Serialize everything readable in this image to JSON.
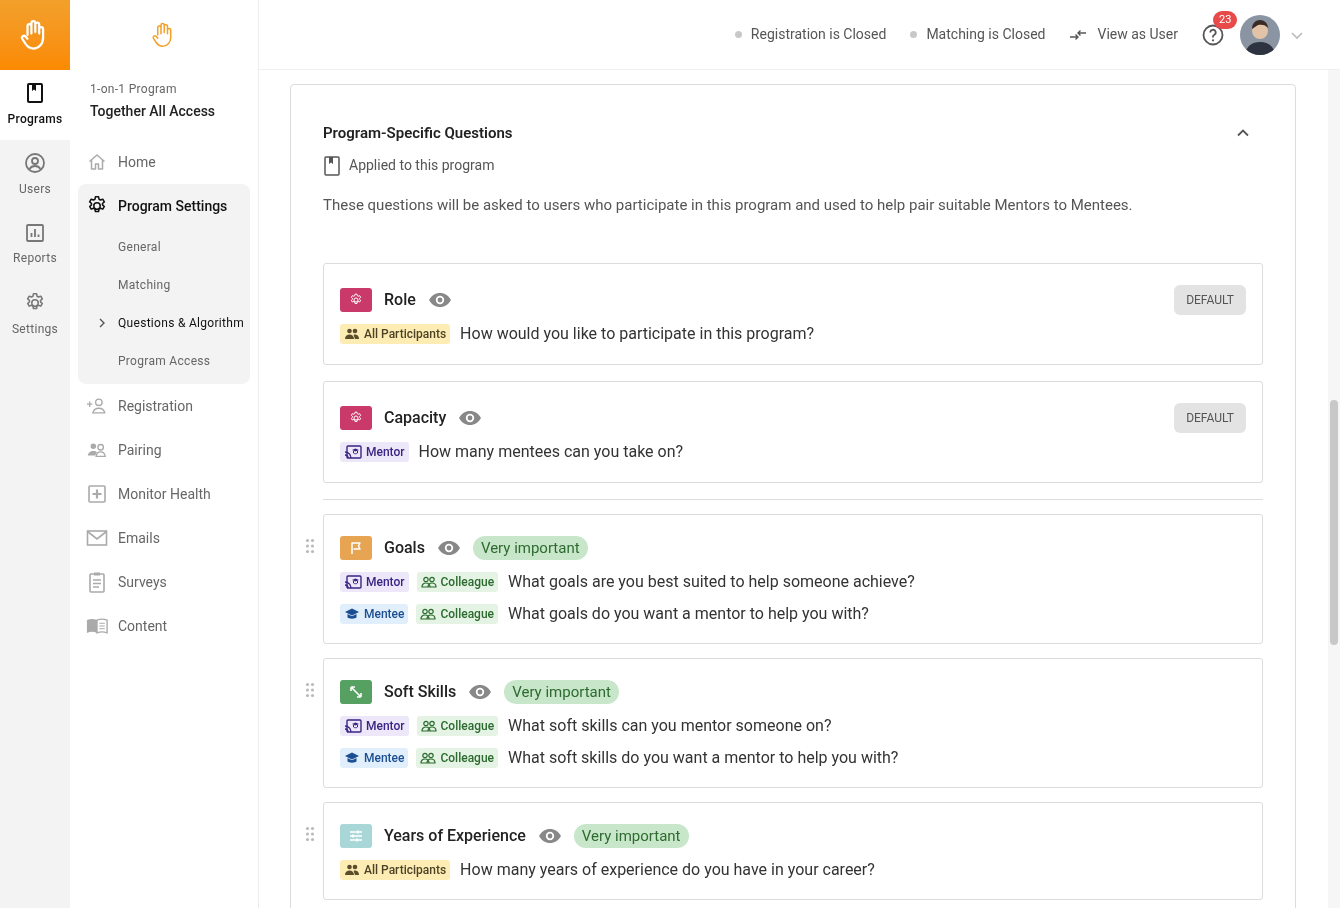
{
  "rail": [
    {
      "label": "Programs",
      "selected": true
    },
    {
      "label": "Users",
      "selected": false
    },
    {
      "label": "Reports",
      "selected": false
    },
    {
      "label": "Settings",
      "selected": false
    }
  ],
  "topbar": {
    "statuses": [
      {
        "label": "Registration is Closed",
        "open": false
      },
      {
        "label": "Matching is Closed",
        "open": false
      }
    ],
    "view_as": "View as User",
    "notification_count": "23"
  },
  "program": {
    "type": "1-on-1 Program",
    "name": "Together All Access"
  },
  "nav": [
    {
      "label": "Home",
      "selected": false
    },
    {
      "label": "Program Settings",
      "selected": true,
      "expanded": true,
      "children": [
        {
          "label": "General",
          "selected": false,
          "has_children": false
        },
        {
          "label": "Matching",
          "selected": false,
          "has_children": false
        },
        {
          "label": "Questions & Algorithm",
          "selected": true,
          "has_children": true
        },
        {
          "label": "Program Access",
          "selected": false,
          "has_children": false
        }
      ]
    },
    {
      "label": "Registration",
      "selected": false
    },
    {
      "label": "Pairing",
      "selected": false
    },
    {
      "label": "Monitor Health",
      "selected": false
    },
    {
      "label": "Emails",
      "selected": false
    },
    {
      "label": "Surveys",
      "selected": false
    },
    {
      "label": "Content",
      "selected": false
    }
  ],
  "section": {
    "title": "Program-Specific Questions",
    "expanded": true,
    "scope": "Applied to this program",
    "description": "These questions will be asked to users who participate in this program and used to help pair suitable Mentors to Mentees."
  },
  "default_questions": [
    {
      "title": "Role",
      "badge": "DEFAULT",
      "rows": [
        {
          "tags": [
            {
              "kind": "all",
              "label": "All Participants"
            }
          ],
          "text": "How would you like to participate in this program?"
        }
      ]
    },
    {
      "title": "Capacity",
      "badge": "DEFAULT",
      "rows": [
        {
          "tags": [
            {
              "kind": "mentor",
              "label": "Mentor"
            }
          ],
          "text": "How many mentees can you take on?"
        }
      ]
    }
  ],
  "custom_questions": [
    {
      "title": "Goals",
      "importance": "Very important",
      "rows": [
        {
          "tags": [
            {
              "kind": "mentor",
              "label": "Mentor"
            },
            {
              "kind": "colleague",
              "label": "Colleague"
            }
          ],
          "text": "What goals are you best suited to help someone achieve?"
        },
        {
          "tags": [
            {
              "kind": "mentee",
              "label": "Mentee"
            },
            {
              "kind": "colleague",
              "label": "Colleague"
            }
          ],
          "text": "What goals do you want a mentor to help you with?"
        }
      ]
    },
    {
      "title": "Soft Skills",
      "importance": "Very important",
      "rows": [
        {
          "tags": [
            {
              "kind": "mentor",
              "label": "Mentor"
            },
            {
              "kind": "colleague",
              "label": "Colleague"
            }
          ],
          "text": "What soft skills can you mentor someone on?"
        },
        {
          "tags": [
            {
              "kind": "mentee",
              "label": "Mentee"
            },
            {
              "kind": "colleague",
              "label": "Colleague"
            }
          ],
          "text": "What soft skills do you want a mentor to help you with?"
        }
      ]
    },
    {
      "title": "Years of Experience",
      "importance": "Very important",
      "rows": [
        {
          "tags": [
            {
              "kind": "all",
              "label": "All Participants"
            }
          ],
          "text": "How many years of experience do you have in your career?"
        }
      ]
    }
  ]
}
